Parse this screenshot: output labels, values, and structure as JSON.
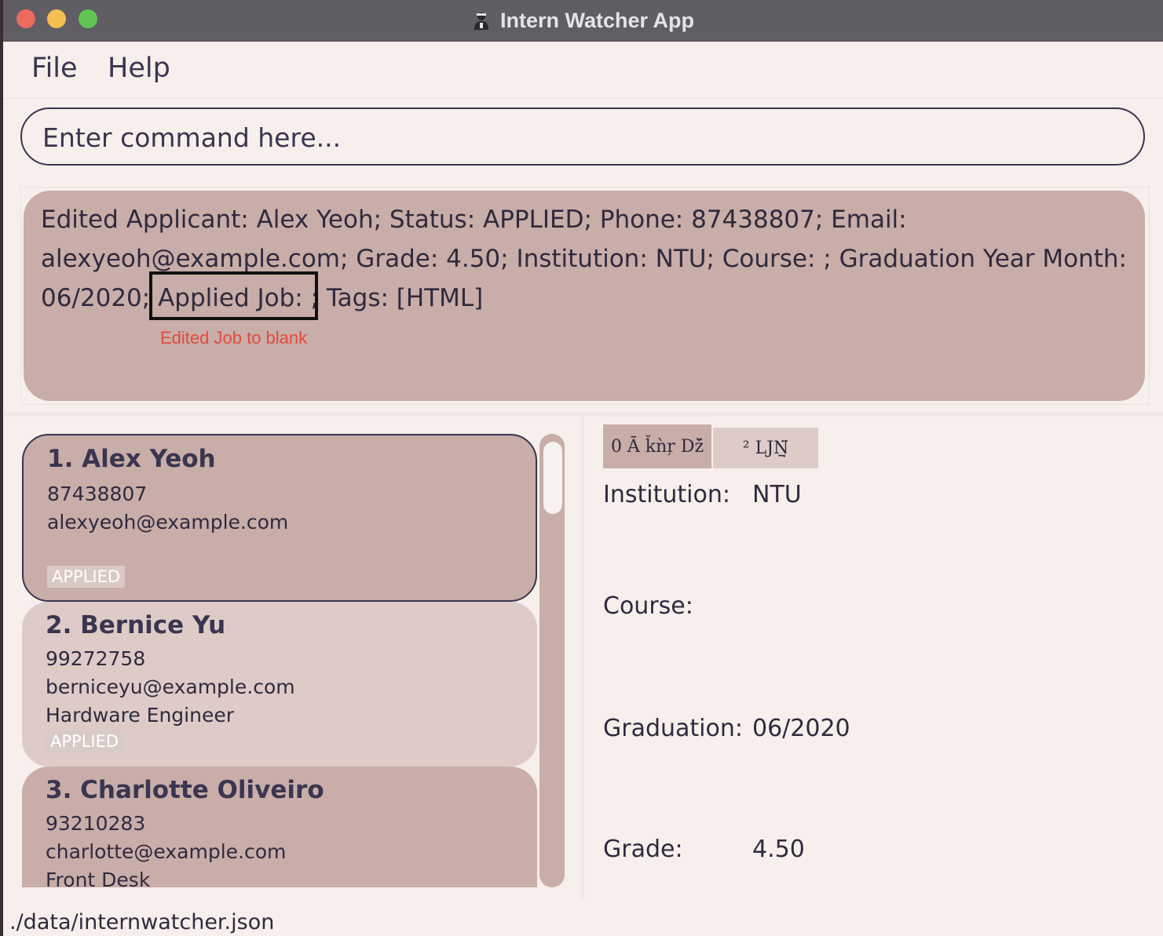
{
  "window": {
    "title": "Intern Watcher App"
  },
  "menu": {
    "file": "File",
    "help": "Help"
  },
  "command": {
    "placeholder": "Enter command here...",
    "value": ""
  },
  "result": {
    "text": "Edited Applicant: Alex Yeoh; Status: APPLIED; Phone: 87438807; Email: alexyeoh@example.com; Grade: 4.50; Institution: NTU; Course: ; Graduation Year Month: 06/2020; Applied Job: ; Tags: [HTML]",
    "annotation": "Edited Job to  blank"
  },
  "applicants": [
    {
      "index": "1.",
      "name": "Alex Yeoh",
      "phone": "87438807",
      "email": "alexyeoh@example.com",
      "job": "",
      "status": "APPLIED"
    },
    {
      "index": "2.",
      "name": "Bernice Yu",
      "phone": "99272758",
      "email": "berniceyu@example.com",
      "job": "Hardware Engineer",
      "status": "APPLIED"
    },
    {
      "index": "3.",
      "name": "Charlotte Oliveiro",
      "phone": "93210283",
      "email": "charlotte@example.com",
      "job": "Front Desk",
      "status": ""
    }
  ],
  "detail": {
    "tabs": [
      "0 Ā ǩǹŗ  ǅ̄",
      "² ǇṈ̣̈"
    ],
    "institution_label": "Institution:",
    "institution_value": "NTU",
    "course_label": "Course:",
    "course_value": "",
    "graduation_label": "Graduation:",
    "graduation_value": "06/2020",
    "grade_label": "Grade:",
    "grade_value": "4.50"
  },
  "status_bar": {
    "path": "./data/internwatcher.json"
  }
}
